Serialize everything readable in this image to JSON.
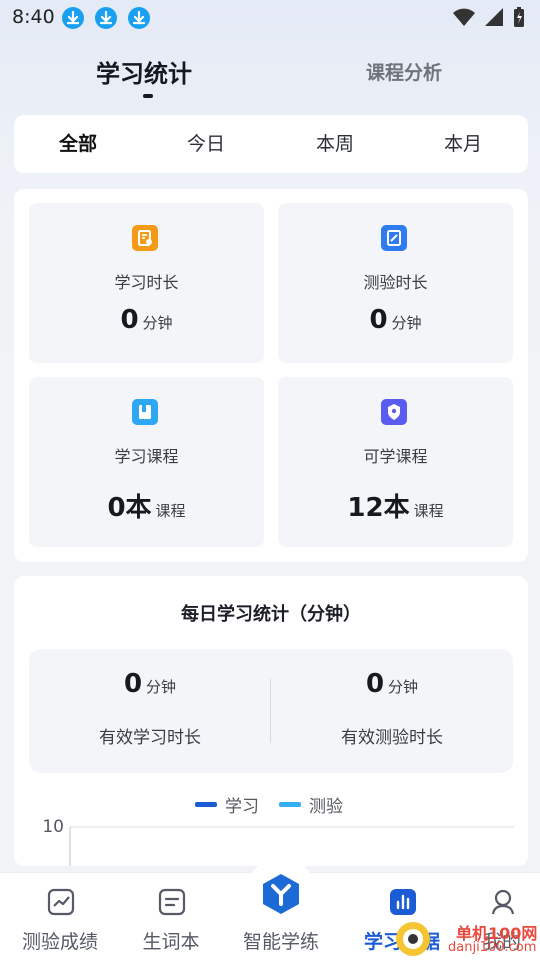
{
  "status_bar": {
    "time": "8:40",
    "icons": [
      "download-icon",
      "download-icon",
      "download-icon",
      "wifi-icon",
      "signal-icon",
      "battery-icon"
    ]
  },
  "top_tabs": [
    {
      "label": "学习统计",
      "active": true
    },
    {
      "label": "课程分析",
      "active": false
    }
  ],
  "period_filter": {
    "options": [
      "全部",
      "今日",
      "本周",
      "本月"
    ],
    "selected": "全部"
  },
  "stats": [
    {
      "label": "学习时长",
      "value": "0",
      "unit": "分钟",
      "icon": "study-duration-icon",
      "color": "#f59a16"
    },
    {
      "label": "测验时长",
      "value": "0",
      "unit": "分钟",
      "icon": "quiz-duration-icon",
      "color": "#2f7cf0"
    },
    {
      "label": "学习课程",
      "value": "0本",
      "unit": "课程",
      "icon": "course-book-icon",
      "color": "#2ea8f5"
    },
    {
      "label": "可学课程",
      "value": "12本",
      "unit": "课程",
      "icon": "available-course-icon",
      "color": "#5a5cf0"
    }
  ],
  "daily": {
    "title": "每日学习统计（分钟）",
    "metrics": [
      {
        "value": "0",
        "unit": "分钟",
        "label": "有效学习时长"
      },
      {
        "value": "0",
        "unit": "分钟",
        "label": "有效测验时长"
      }
    ]
  },
  "chart_data": {
    "type": "line",
    "series": [
      {
        "name": "学习",
        "color": "#1c5bd6",
        "values": []
      },
      {
        "name": "测验",
        "color": "#35aef5",
        "values": []
      }
    ],
    "y_tick_labels": [
      "10"
    ],
    "grid": true
  },
  "bottom_nav": [
    {
      "label": "测验成绩",
      "icon": "trend-chart-icon",
      "active": false
    },
    {
      "label": "生词本",
      "icon": "notebook-icon",
      "active": false
    },
    {
      "label": "智能学练",
      "icon": "smart-practice-icon",
      "active": false
    },
    {
      "label": "学习数据",
      "icon": "bar-chart-icon",
      "active": true
    },
    {
      "label": "我的",
      "icon": "user-icon",
      "active": false
    }
  ],
  "watermark": {
    "title": "单机100网",
    "subtitle": "danji100.com"
  }
}
